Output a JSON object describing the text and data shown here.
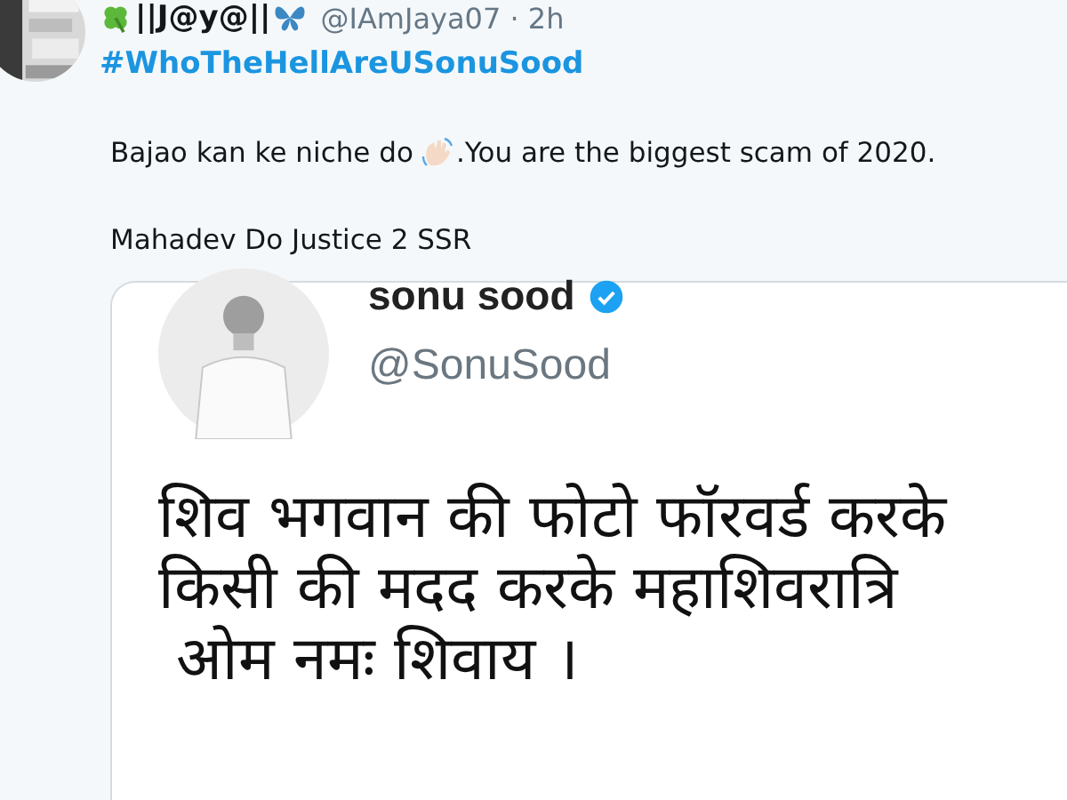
{
  "tweet": {
    "author": {
      "display_name": "||J@y@||",
      "handle_time": "@IAmJaya07 · 2h"
    },
    "hashtag": "#WhoTheHellAreUSonuSood",
    "text_before": "Bajao kan ke niche do",
    "text_after": ".You are the biggest scam of 2020.",
    "line_2": "Mahadev Do Justice 2 SSR",
    "embedded": {
      "name": "sonu sood",
      "verified": true,
      "handle": "@SonuSood",
      "lines": [
        "शिव भगवान की फोटो फॉरवर्ड करके",
        "किसी की मदद करके महाशिवरात्रि",
        "ओम नमः शिवाय ।"
      ]
    }
  }
}
